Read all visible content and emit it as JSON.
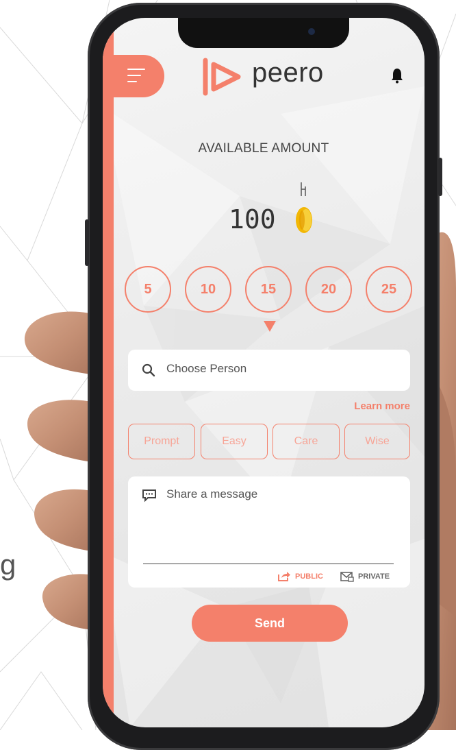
{
  "app": {
    "brand": "peero"
  },
  "header": {
    "menu_icon": "hamburger-menu-icon",
    "notification_icon": "bell-icon"
  },
  "balance": {
    "label": "AVAILABLE AMOUNT",
    "value": "100",
    "currency_icon": "coin-icon"
  },
  "amounts": [
    "5",
    "10",
    "15",
    "20",
    "25"
  ],
  "search": {
    "placeholder": "Choose Person",
    "icon": "search-icon"
  },
  "learn_more": "Learn more",
  "tags": [
    "Prompt",
    "Easy",
    "Care",
    "Wise"
  ],
  "message": {
    "placeholder": "Share a message",
    "icon": "chat-icon",
    "public_label": "PUBLIC",
    "private_label": "PRIVATE"
  },
  "send_label": "Send",
  "background_text": "g",
  "colors": {
    "accent": "#f4806b",
    "tag_text": "#f7a597",
    "coin": "#f2b705"
  }
}
